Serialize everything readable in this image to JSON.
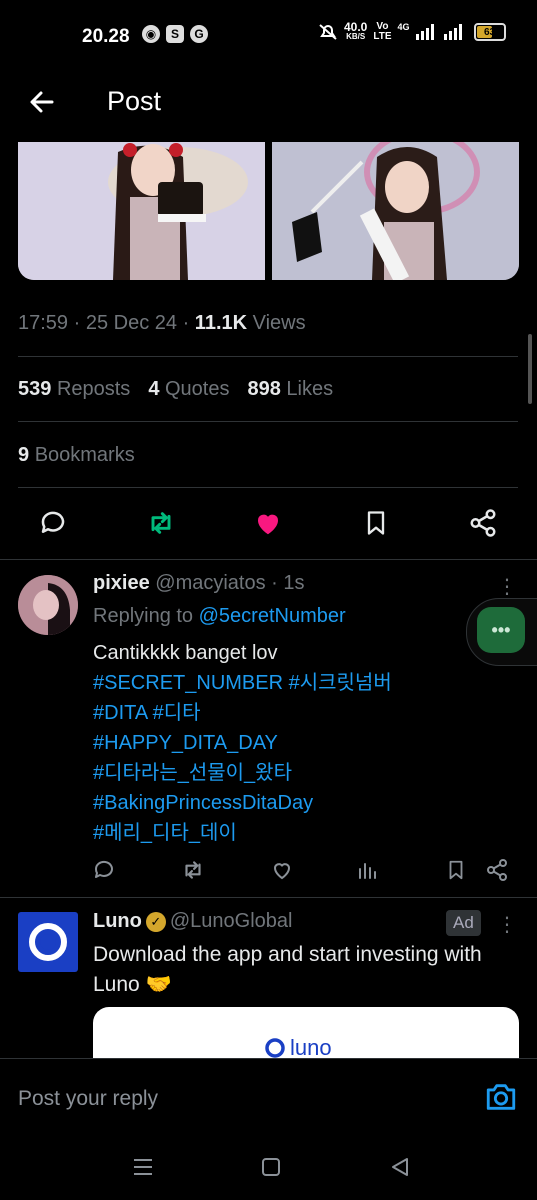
{
  "status_bar": {
    "time": "20.28",
    "net_speed_value": "40.0",
    "net_speed_unit": "KB/S",
    "volte_label": "Vo",
    "lte_label": "LTE",
    "network_label": "4G",
    "battery": "63"
  },
  "header": {
    "title": "Post"
  },
  "post": {
    "time": "17:59",
    "date": "25 Dec 24",
    "views_count": "11.1K",
    "views_label": "Views",
    "reposts_count": "539",
    "reposts_label": "Reposts",
    "quotes_count": "4",
    "quotes_label": "Quotes",
    "likes_count": "898",
    "likes_label": "Likes",
    "bookmarks_count": "9",
    "bookmarks_label": "Bookmarks",
    "liked": true,
    "reposted": true
  },
  "reply": {
    "name": "pixiee",
    "handle": "@macyiatos",
    "time": "1s",
    "replying_prefix": "Replying to",
    "replying_to": "@5ecretNumber",
    "line1": "Cantikkkk banget lov",
    "line2": "#SECRET_NUMBER #시크릿넘버",
    "line3": "#DITA #디타",
    "line4": "#HAPPY_DITA_DAY",
    "line5": "#디타라는_선물이_왔타",
    "line6": "#BakingPrincessDitaDay",
    "line7": "#메리_디타_데이"
  },
  "ad": {
    "name": "Luno",
    "handle": "@LunoGlobal",
    "badge": "Ad",
    "text": "Download the app and start investing with Luno 🤝",
    "card_logo_text": "luno"
  },
  "composer": {
    "placeholder": "Post your reply"
  },
  "colors": {
    "accent_blue": "#1d9bf0",
    "repost_green": "#00ba7c",
    "like_pink": "#f91880",
    "luno_blue": "#1a3fc4"
  }
}
